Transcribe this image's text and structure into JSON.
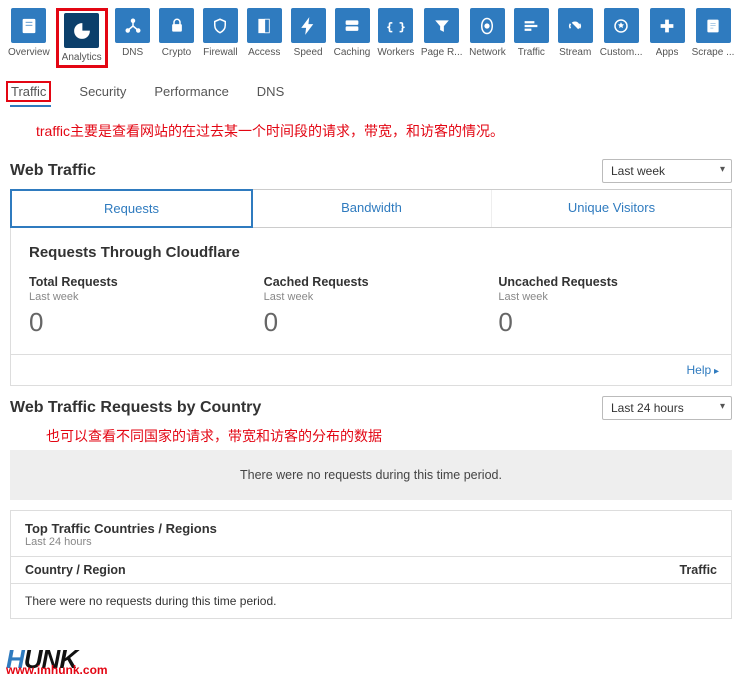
{
  "topnav": [
    {
      "label": "Overview",
      "icon": "overview"
    },
    {
      "label": "Analytics",
      "icon": "analytics"
    },
    {
      "label": "DNS",
      "icon": "dns"
    },
    {
      "label": "Crypto",
      "icon": "crypto"
    },
    {
      "label": "Firewall",
      "icon": "firewall"
    },
    {
      "label": "Access",
      "icon": "access"
    },
    {
      "label": "Speed",
      "icon": "speed"
    },
    {
      "label": "Caching",
      "icon": "caching"
    },
    {
      "label": "Workers",
      "icon": "workers"
    },
    {
      "label": "Page R...",
      "icon": "pagerules"
    },
    {
      "label": "Network",
      "icon": "network"
    },
    {
      "label": "Traffic",
      "icon": "traffic"
    },
    {
      "label": "Stream",
      "icon": "stream"
    },
    {
      "label": "Custom...",
      "icon": "custom"
    },
    {
      "label": "Apps",
      "icon": "apps"
    },
    {
      "label": "Scrape ...",
      "icon": "scrape"
    }
  ],
  "subtabs": {
    "traffic": "Traffic",
    "security": "Security",
    "performance": "Performance",
    "dns": "DNS"
  },
  "annotation1": "traffic主要是查看网站的在过去某一个时间段的请求，带宽，和访客的情况。",
  "webTraffic": {
    "title": "Web Traffic",
    "range": "Last week",
    "tabs": {
      "requests": "Requests",
      "bandwidth": "Bandwidth",
      "unique": "Unique Visitors"
    },
    "panelTitle": "Requests Through Cloudflare",
    "stats": [
      {
        "name": "Total Requests",
        "sub": "Last week",
        "val": "0"
      },
      {
        "name": "Cached Requests",
        "sub": "Last week",
        "val": "0"
      },
      {
        "name": "Uncached Requests",
        "sub": "Last week",
        "val": "0"
      }
    ],
    "help": "Help"
  },
  "byCountry": {
    "title": "Web Traffic Requests by Country",
    "range": "Last 24 hours",
    "annotation": "也可以查看不同国家的请求，带宽和访客的分布的数据",
    "empty": "There were no requests during this time period.",
    "ttcTitle": "Top Traffic Countries / Regions",
    "ttcSub": "Last 24 hours",
    "colCountry": "Country / Region",
    "colTraffic": "Traffic",
    "ttcEmpty": "There were no requests during this time period."
  },
  "footer": {
    "url": "www.imhunk.com"
  }
}
